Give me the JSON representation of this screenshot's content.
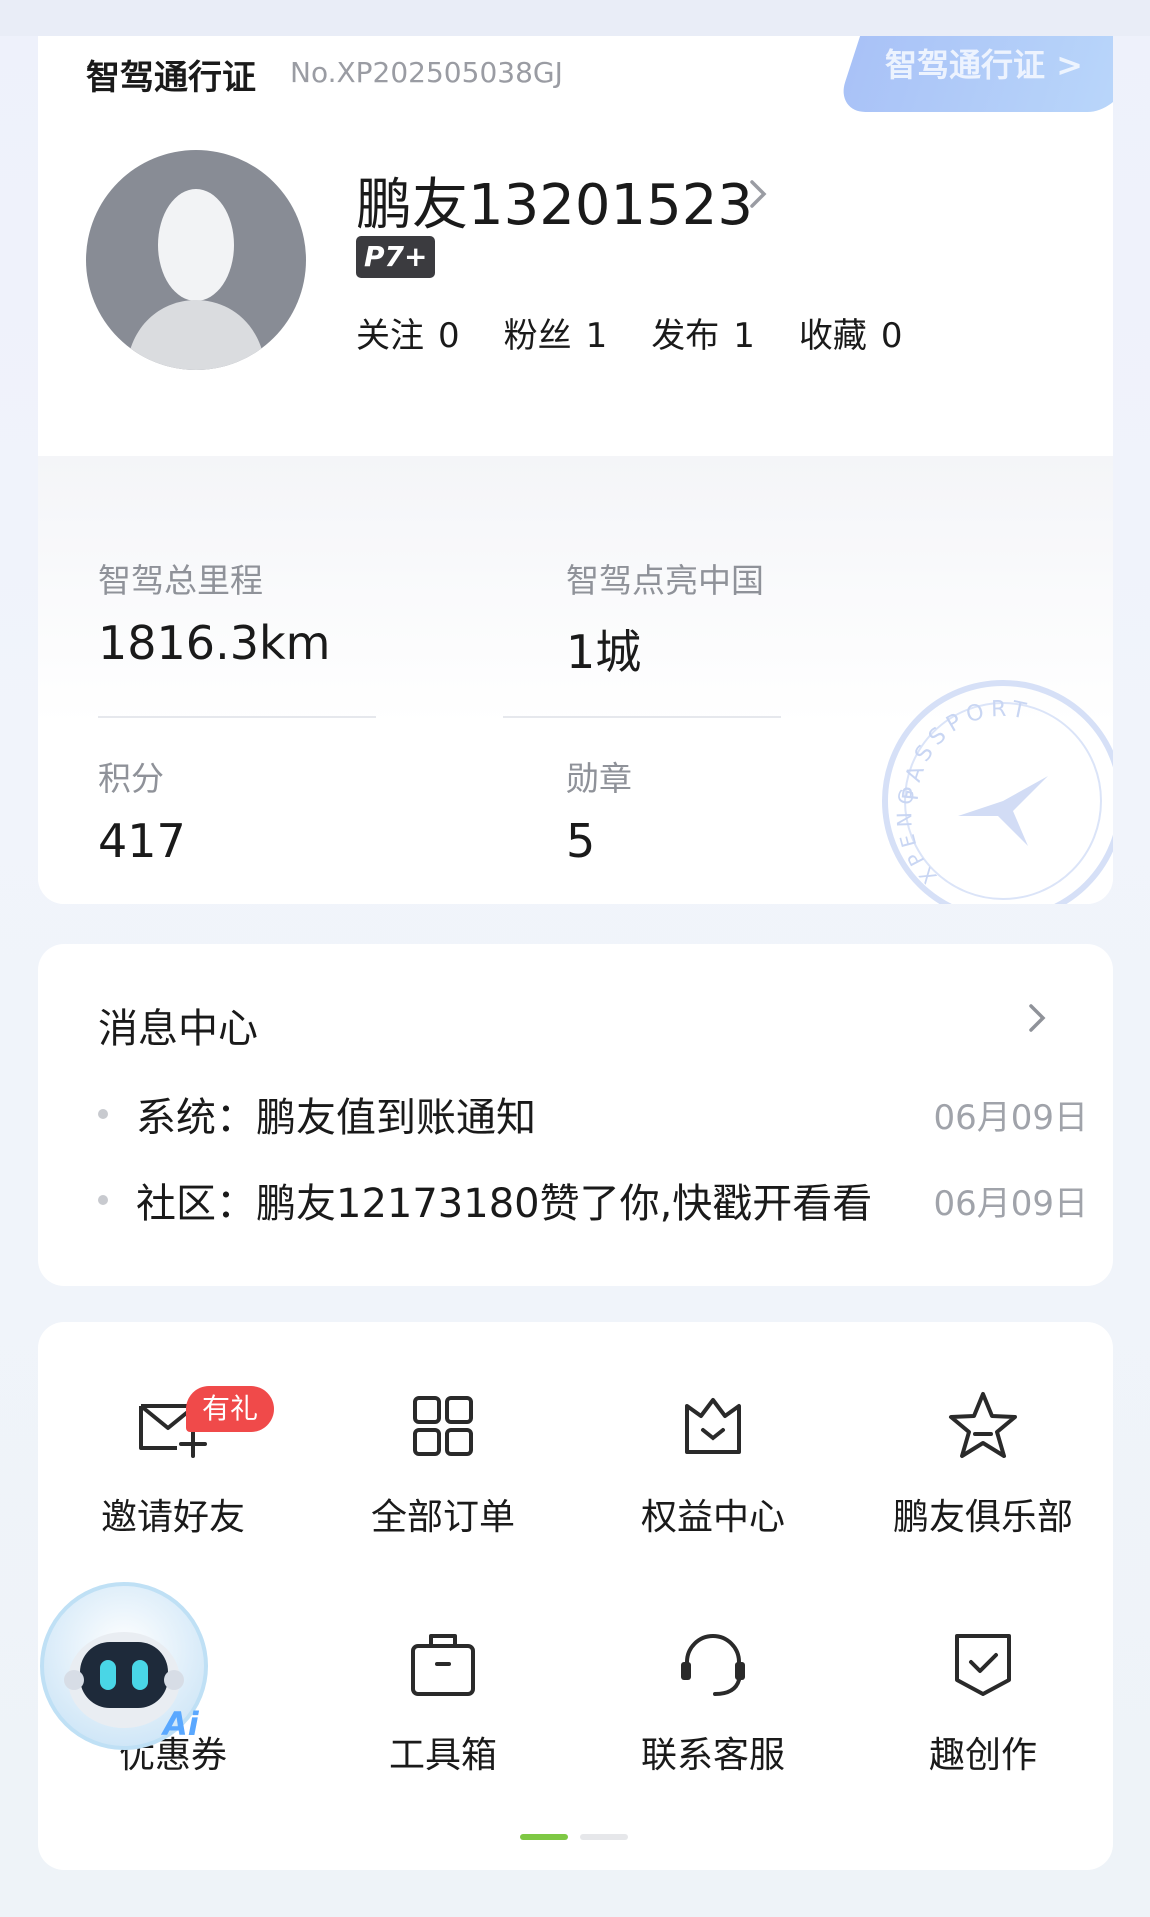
{
  "passport": {
    "title": "智驾通行证",
    "number": "No.XP202505038GJ",
    "tab_label": "智驾通行证 >",
    "username": "鹏友13201523",
    "model_badge": "P7+",
    "social": [
      {
        "label": "关注",
        "value": "0"
      },
      {
        "label": "粉丝",
        "value": "1"
      },
      {
        "label": "发布",
        "value": "1"
      },
      {
        "label": "收藏",
        "value": "0"
      }
    ],
    "stats": {
      "mileage": {
        "label": "智驾总里程",
        "value": "1816.3km"
      },
      "cities": {
        "label": "智驾点亮中国",
        "value": "1城"
      },
      "points": {
        "label": "积分",
        "value": "417"
      },
      "medals": {
        "label": "勋章",
        "value": "5"
      }
    },
    "stamp_text": "PASSPORT",
    "stamp_text2": "XPENG"
  },
  "messages": {
    "title": "消息中心",
    "items": [
      {
        "category": "系统：",
        "text": "鹏友值到账通知",
        "date": "06月09日"
      },
      {
        "category": "社区：",
        "text": "鹏友12173180赞了你,快戳开看看",
        "date": "06月09日"
      }
    ]
  },
  "services": {
    "gift_badge": "有礼",
    "items": [
      {
        "label": "邀请好友",
        "icon": "mail-plus-icon"
      },
      {
        "label": "全部订单",
        "icon": "grid-icon"
      },
      {
        "label": "权益中心",
        "icon": "crown-box-icon"
      },
      {
        "label": "鹏友俱乐部",
        "icon": "star-icon"
      },
      {
        "label": "优惠券",
        "icon": "coupon-icon"
      },
      {
        "label": "工具箱",
        "icon": "toolbox-icon"
      },
      {
        "label": "联系客服",
        "icon": "headset-icon"
      },
      {
        "label": "趣创作",
        "icon": "shield-check-icon"
      }
    ],
    "page_index": 1,
    "page_count": 2
  },
  "assistant": {
    "label": "Ai",
    "icon": "robot-assistant-icon"
  },
  "colors": {
    "accent_green": "#7ec844",
    "badge_red": "#f04a4a",
    "tab_blue": "#a9c2f7"
  }
}
